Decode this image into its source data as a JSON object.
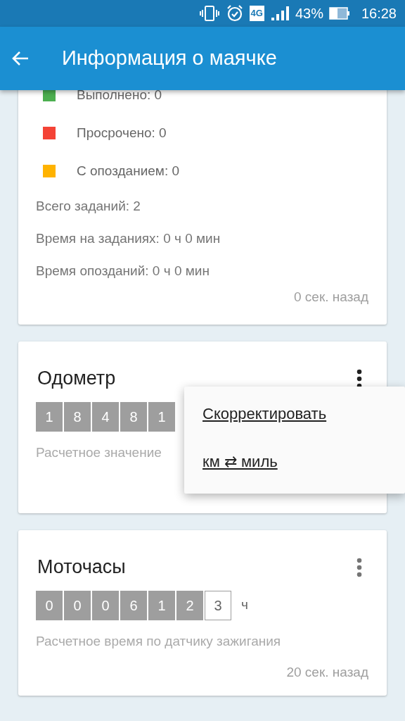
{
  "status_bar": {
    "network": "4G",
    "battery": "43%",
    "time": "16:28"
  },
  "app_bar": {
    "title": "Информация о маячке"
  },
  "tasks_card": {
    "legend": [
      {
        "label": "Выполнено: 0",
        "color": "#4caf50"
      },
      {
        "label": "Просрочено: 0",
        "color": "#f44336"
      },
      {
        "label": "С опозданием: 0",
        "color": "#ffb300"
      }
    ],
    "stats": [
      "Всего заданий: 2",
      "Время на заданиях: 0 ч 0 мин",
      "Время опозданий: 0 ч 0 мин"
    ],
    "updated": "0 сек. назад"
  },
  "odometer_card": {
    "title": "Одометр",
    "digits": [
      {
        "value": "1",
        "outlined": false
      },
      {
        "value": "8",
        "outlined": false
      },
      {
        "value": "4",
        "outlined": false
      },
      {
        "value": "8",
        "outlined": false
      },
      {
        "value": "1",
        "outlined": false
      }
    ],
    "caption": "Расчетное значение"
  },
  "menu": {
    "items": [
      {
        "label": "Скорректировать"
      },
      {
        "label": "км ⇄ миль"
      }
    ]
  },
  "hours_card": {
    "title": "Моточасы",
    "digits": [
      {
        "value": "0",
        "outlined": false
      },
      {
        "value": "0",
        "outlined": false
      },
      {
        "value": "0",
        "outlined": false
      },
      {
        "value": "6",
        "outlined": false
      },
      {
        "value": "1",
        "outlined": false
      },
      {
        "value": "2",
        "outlined": false
      },
      {
        "value": "3",
        "outlined": true
      }
    ],
    "unit": "ч",
    "caption": "Расчетное время по датчику зажигания",
    "updated": "20 сек. назад"
  }
}
